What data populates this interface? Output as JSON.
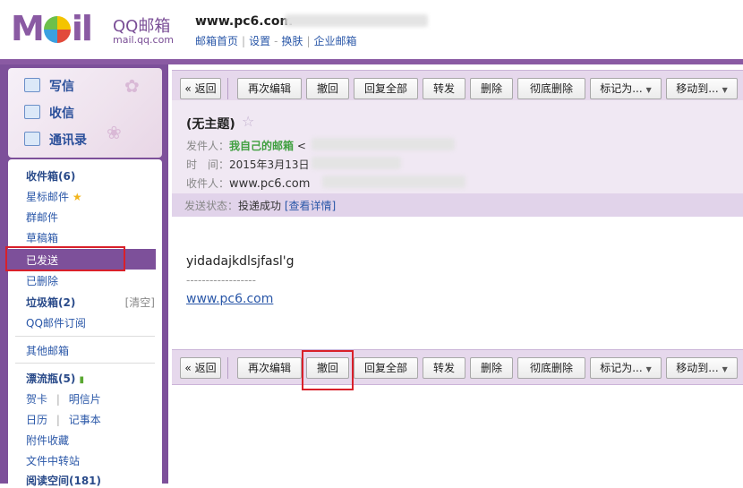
{
  "header": {
    "logo_text": "M  il",
    "brand": "QQ邮箱",
    "brand_domain": "mail.qq.com",
    "user_name": "www.pc6.com",
    "links": [
      "邮箱首页",
      "设置",
      "换肤",
      "企业邮箱"
    ],
    "link_sep_1": "|",
    "link_sep_2": "-",
    "link_sep_3": "|"
  },
  "sidebar": {
    "quick": [
      {
        "label": "写信",
        "icon": "pencil-icon"
      },
      {
        "label": "收信",
        "icon": "inbox-download-icon"
      },
      {
        "label": "通讯录",
        "icon": "contacts-card-icon"
      }
    ],
    "folders": {
      "inbox": "收件箱(6)",
      "starred": "星标邮件",
      "group": "群邮件",
      "drafts": "草稿箱",
      "sent": "已发送",
      "deleted": "已删除",
      "spam": "垃圾箱(2)",
      "spam_clear": "[清空]",
      "subscriptions": "QQ邮件订阅",
      "other": "其他邮箱",
      "bottle": "漂流瓶(5)",
      "card": "贺卡",
      "postcard": "明信片",
      "calendar": "日历",
      "notes": "记事本",
      "attachments": "附件收藏",
      "transfer": "文件中转站",
      "reading": "阅读空间(181)",
      "pipe": "|"
    }
  },
  "toolbar": {
    "back": "« 返回",
    "reedit": "再次编辑",
    "recall": "撤回",
    "reply_all": "回复全部",
    "forward": "转发",
    "delete": "删除",
    "purge": "彻底删除",
    "mark_as": "标记为...",
    "move_to": "移动到..."
  },
  "message": {
    "subject": "(无主题)",
    "sender_label": "发件人：",
    "sender_name": "我自己的邮箱",
    "sender_lt": "<",
    "time_label": "时　间：",
    "time_value": "2015年3月13日",
    "recipient_label": "收件人：",
    "recipient_value": "www.pc6.com",
    "status_label": "发送状态：",
    "status_value": "投递成功",
    "status_link": "[查看详情]",
    "body_line": "yidadajkdlsjfasl'g",
    "body_dashes": "------------------",
    "body_link": "www.pc6.com"
  },
  "colors": {
    "brand_purple": "#8a5aa3",
    "selected_folder_bg": "#7d509a",
    "toolbar_bg": "#e6d8ec",
    "highlight_box": "#d9202a",
    "sender_green": "#3f9f3f",
    "link_blue": "#2a57a8"
  }
}
